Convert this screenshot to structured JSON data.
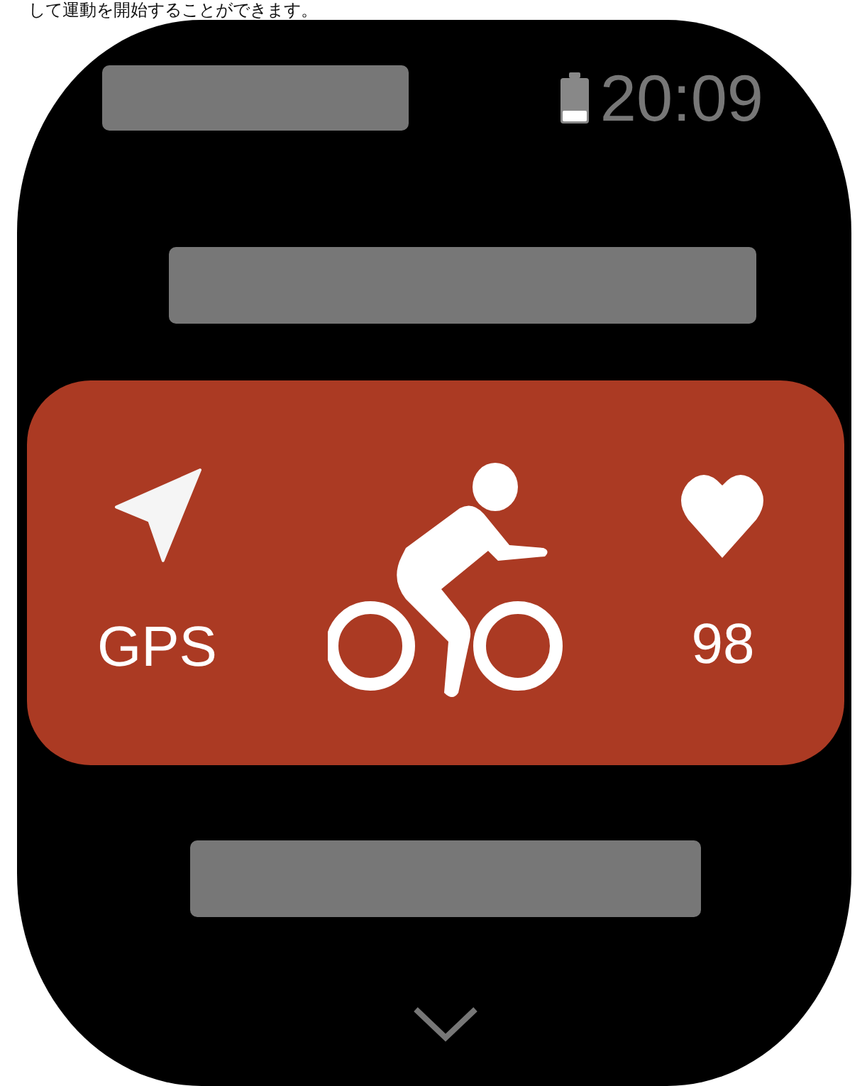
{
  "caption": "して運動を開始することができます。",
  "status_bar": {
    "time": "20:09"
  },
  "workout_card": {
    "items": [
      {
        "kind": "gps",
        "label": "GPS"
      },
      {
        "kind": "cycling"
      },
      {
        "kind": "heart",
        "label": "98"
      }
    ]
  }
}
